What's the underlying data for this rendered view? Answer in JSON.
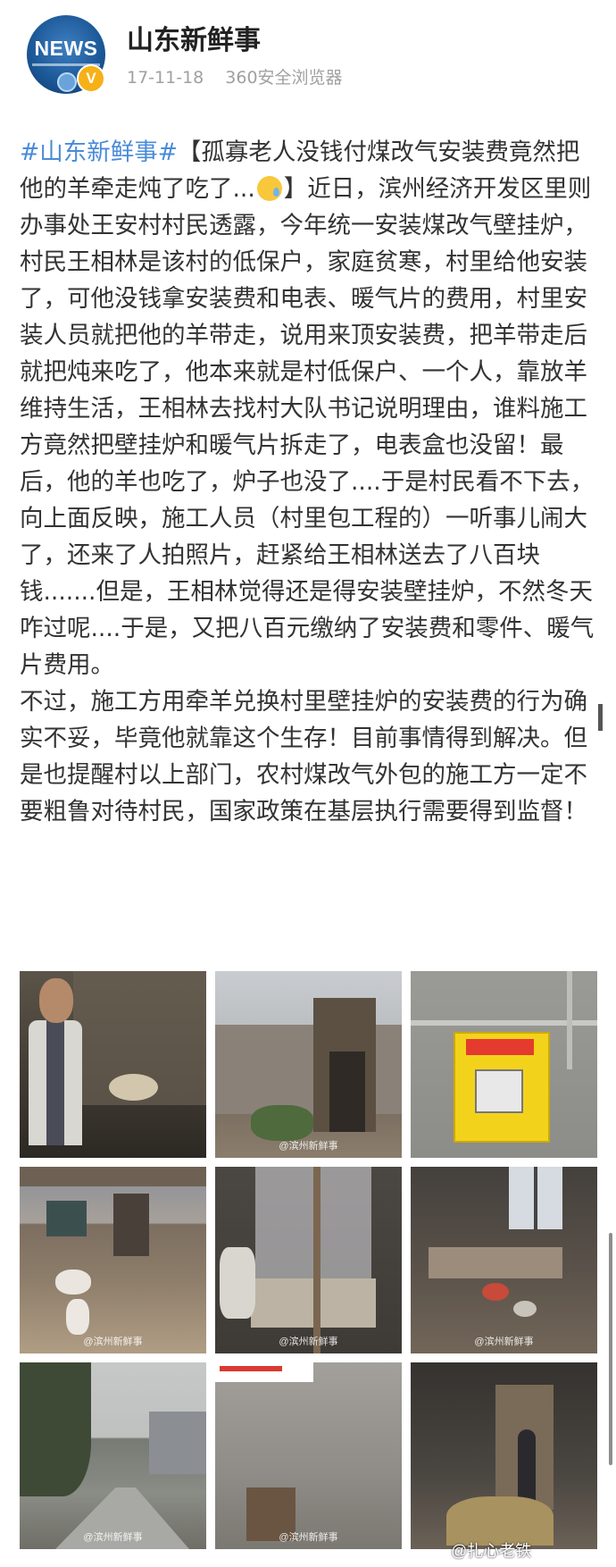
{
  "header": {
    "avatar_text": "NEWS",
    "badge": "V",
    "username": "山东新鲜事",
    "date": "17-11-18",
    "source": "360安全浏览器"
  },
  "post": {
    "hashtag": "#山东新鲜事#",
    "paragraph1_before_emoji": "【孤寡老人没钱付煤改气安装费竟然把他的羊牵走炖了吃了...",
    "paragraph1_after_emoji": "】近日，滨州经济开发区里则办事处王安村村民透露，今年统一安装煤改气壁挂炉，村民王相林是该村的低保户，家庭贫寒，村里给他安装了，可他没钱拿安装费和电表、暖气片的费用，村里安装人员就把他的羊带走，说用来顶安装费，把羊带走后就把炖来吃了，他本来就是村低保户、一个人，靠放羊维持生活，王相林去找村大队书记说明理由，谁料施工方竟然把壁挂炉和暖气片拆走了，电表盒也没留！最后，他的羊也吃了，炉子也没了....于是村民看不下去，向上面反映，施工人员（村里包工程的）一听事儿闹大了，还来了人拍照片，赶紧给王相林送去了八百块钱.......但是，王相林觉得还是得安装壁挂炉，不然冬天咋过呢....于是，又把八百元缴纳了安装费和零件、暖气片费用。",
    "paragraph2": "不过，施工方用牵羊兑换村里壁挂炉的安装费的行为确实不妥，毕竟他就靠这个生存！目前事情得到解决。但是也提醒村以上部门，农村煤改气外包的施工方一定不要粗鲁对待村民，国家政策在基层执行需要得到监督！"
  },
  "images": {
    "watermarks": [
      "@滨州新鲜事",
      "@滨州新鲜事",
      "@滨州新鲜事",
      "@滨州新鲜事",
      "@滨州新鲜事",
      "@滨州新鲜事"
    ],
    "bottom_watermark": "@扎心老铁"
  }
}
